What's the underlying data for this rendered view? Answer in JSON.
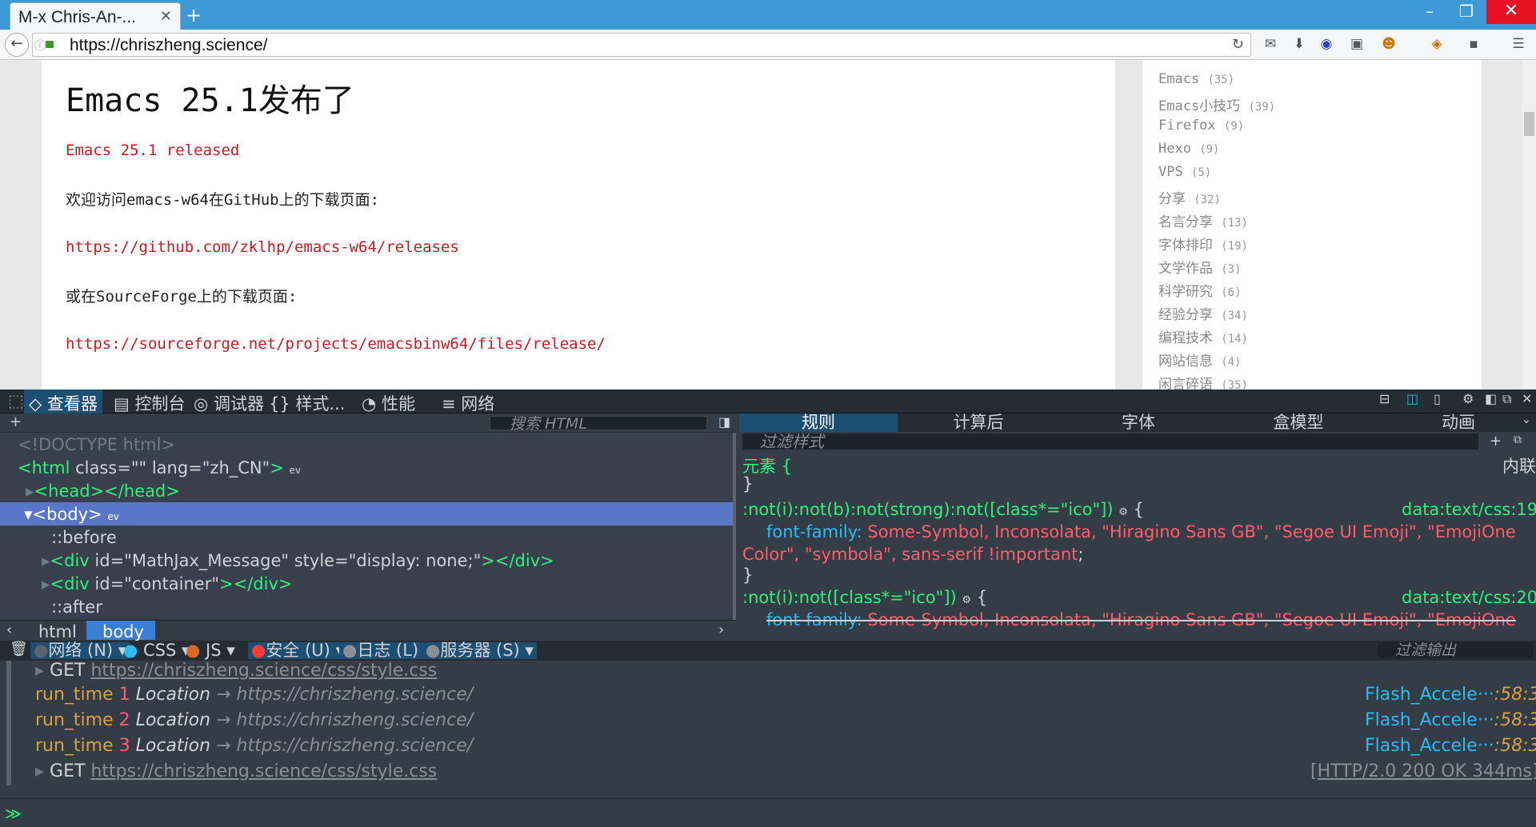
{
  "browser": {
    "tab_title": "M-x Chris-An-...",
    "new_tab": "+",
    "url": "https://chriszheng.science/"
  },
  "article": {
    "title": "Emacs 25.1发布了",
    "subtitle": "Emacs 25.1 released",
    "p1": "欢迎访问emacs-w64在GitHub上的下载页面:",
    "link1": "https://github.com/zklhp/emacs-w64/releases",
    "p2": "或在SourceForge上的下载页面:",
    "link2": "https://sourceforge.net/projects/emacsbinw64/files/release/"
  },
  "sidebar": {
    "categories": [
      {
        "name": "Emacs",
        "count": "(35)"
      },
      {
        "name": "Emacs小技巧",
        "count": "(39)"
      },
      {
        "name": "Firefox",
        "count": "(9)"
      },
      {
        "name": "Hexo",
        "count": "(9)"
      },
      {
        "name": "VPS",
        "count": "(5)"
      },
      {
        "name": "分享",
        "count": "(32)"
      },
      {
        "name": "名言分享",
        "count": "(13)"
      },
      {
        "name": "字体排印",
        "count": "(19)"
      },
      {
        "name": "文学作品",
        "count": "(3)"
      },
      {
        "name": "科学研究",
        "count": "(6)"
      },
      {
        "name": "经验分享",
        "count": "(34)"
      },
      {
        "name": "编程技术",
        "count": "(14)"
      },
      {
        "name": "网站信息",
        "count": "(4)"
      },
      {
        "name": "闲言碎语",
        "count": "(35)"
      }
    ]
  },
  "devtools": {
    "tabs": {
      "inspector": "查看器",
      "console": "控制台",
      "debugger": "调试器",
      "style": "样式...",
      "perf": "性能",
      "network": "网络"
    },
    "search_html": "搜索 HTML",
    "markup": {
      "doctype": "<!DOCTYPE html>",
      "html_open": "<html",
      "html_attrs": " class=\"\" lang=\"zh_CN\"",
      "html_close": ">",
      "head": "<head></head>",
      "body": "<body>",
      "before": "::before",
      "div1_open": "<div",
      "div1_attrs": " id=\"MathJax_Message\" style=\"display: none;\"",
      "div1_close": "></div>",
      "div2_open": "<div",
      "div2_attrs": " id=\"container\"",
      "div2_close": "></div>",
      "after": "::after"
    },
    "breadcrumbs": {
      "html": "html",
      "body": "body"
    },
    "side_tabs": {
      "rules": "规则",
      "computed": "计算后",
      "fonts": "字体",
      "box": "盒模型",
      "anim": "动画"
    },
    "filter_styles": "过滤样式",
    "rules": {
      "element": "元素 {",
      "close": "}",
      "inline": "内联",
      "r1_sel": ":not(i):not(b):not(strong):not([class*=\"ico\"])",
      "r1_brace": " {",
      "r1_src": "data:text/css:19",
      "r1_prop": "font-family:",
      "r1_val": " Some-Symbol, Inconsolata, \"Hiragino Sans GB\", \"Segoe UI Emoji\", \"EmojiOne",
      "r1_val2": "Color\", \"symbola\", sans-serif !important",
      "semicolon": ";",
      "r2_sel": ":not(i):not([class*=\"ico\"])",
      "r2_brace": " {",
      "r2_src": "data:text/css:20",
      "r2_prop": "font-family:",
      "r2_val": " Some-Symbol, Inconsolata, \"Hiragino Sans GB\", \"Segoe UI Emoji\", \"EmojiOne"
    },
    "console_filters": {
      "net": "网络 (N)",
      "css": "CSS",
      "js": "JS",
      "security": "安全 (U)",
      "log": "日志 (L)",
      "server": "服务器 (S)"
    },
    "filter_output": "过滤输出",
    "console": {
      "get1": "GET",
      "get1_url": "https://chriszheng.science/css/style.css",
      "rt": "run_time",
      "n1": "1",
      "n2": "2",
      "n3": "3",
      "loc": "Location",
      "arrow": "→",
      "dest": "https://chriszheng.science/",
      "src": "Flash_Accele···",
      "line": ":58:3",
      "get2": "GET",
      "get2_url": "https://chriszheng.science/css/style.css",
      "status": "[HTTP/2.0 200 OK 344ms]",
      "prompt": "≫"
    }
  }
}
